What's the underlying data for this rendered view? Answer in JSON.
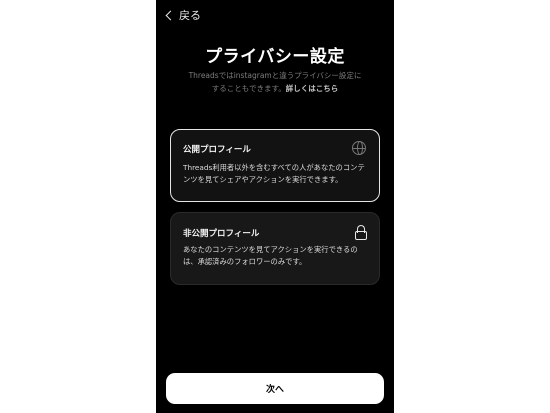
{
  "nav": {
    "back_label": "戻る"
  },
  "page": {
    "title": "プライバシー設定",
    "description_line1": "Threadsではinstagramと違うプライバシー設定に",
    "description_line2": "することもできます。",
    "details_link": "詳しくはこちら"
  },
  "options": {
    "public": {
      "title": "公開プロフィール",
      "description": "Threads利用者以外を含むすべての人があなたのコンテンツを見てシェアやアクションを実行できます。",
      "icon": "globe-icon",
      "selected": true
    },
    "private": {
      "title": "非公開プロフィール",
      "description": "あなたのコンテンツを見てアクションを実行できるのは、承認済みのフォロワーのみです。",
      "icon": "lock-icon",
      "selected": false
    }
  },
  "footer": {
    "next_label": "次へ"
  }
}
